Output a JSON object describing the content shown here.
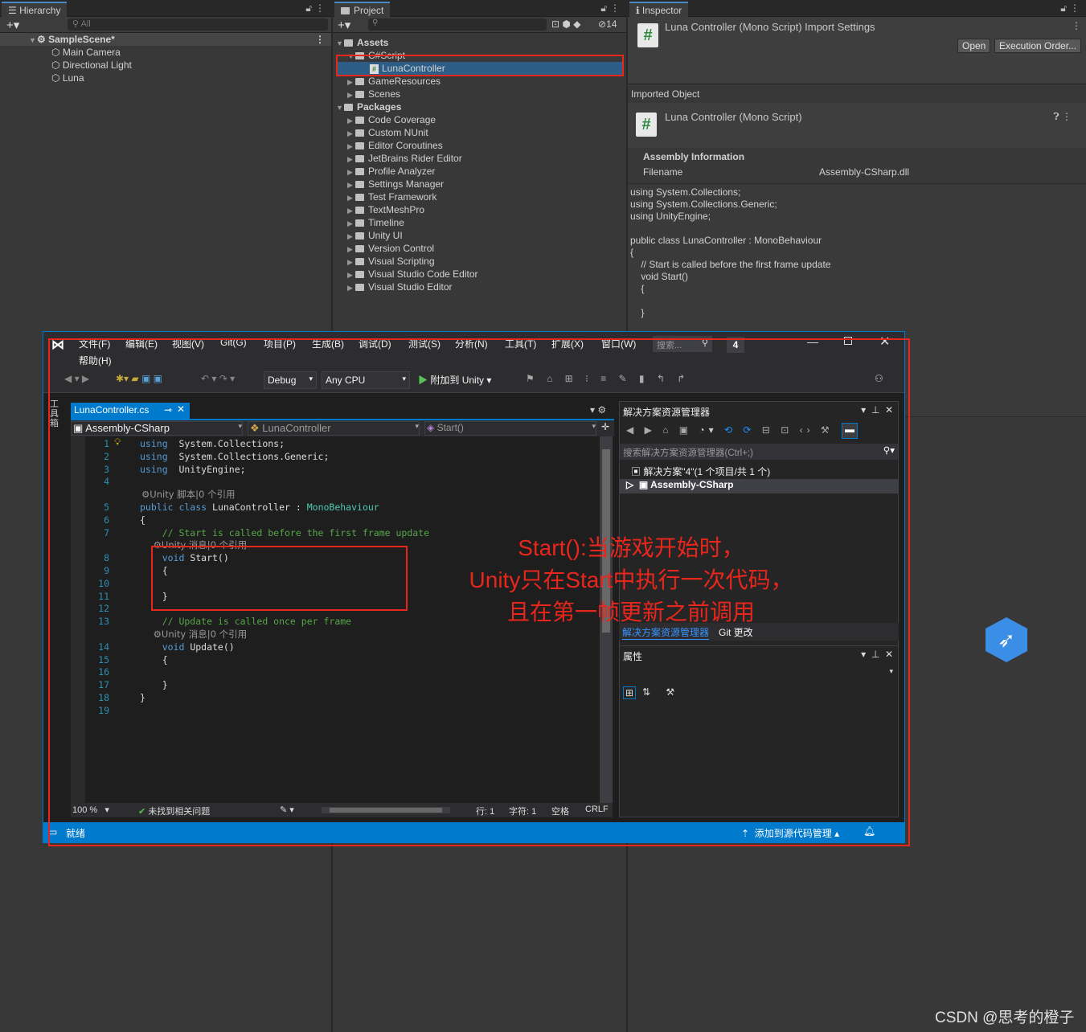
{
  "hierarchy": {
    "tab": "Hierarchy",
    "search_placeholder": "All",
    "scene": "SampleScene*",
    "items": [
      "Main Camera",
      "Directional Light",
      "Luna"
    ]
  },
  "project": {
    "tab": "Project",
    "badge": "14",
    "assets_label": "Assets",
    "folder_csharp": "C#Script",
    "selected_file": "LunaController",
    "asset_folders": [
      "GameResources",
      "Scenes"
    ],
    "packages_label": "Packages",
    "packages": [
      "Code Coverage",
      "Custom NUnit",
      "Editor Coroutines",
      "JetBrains Rider Editor",
      "Profile Analyzer",
      "Settings Manager",
      "Test Framework",
      "TextMeshPro",
      "Timeline",
      "Unity UI",
      "Version Control",
      "Visual Scripting",
      "Visual Studio Code Editor",
      "Visual Studio Editor"
    ]
  },
  "inspector": {
    "tab": "Inspector",
    "title": "Luna Controller (Mono Script) Import Settings",
    "open_btn": "Open",
    "exec_btn": "Execution Order...",
    "imported_object": "Imported Object",
    "object_name": "Luna Controller (Mono Script)",
    "assembly_info": "Assembly Information",
    "filename_label": "Filename",
    "filename_value": "Assembly-CSharp.dll",
    "code_lines": [
      "using System.Collections;",
      "using System.Collections.Generic;",
      "using UnityEngine;",
      "",
      "public class LunaController : MonoBehaviour",
      "{",
      "    // Start is called before the first frame update",
      "    void Start()",
      "    {",
      "",
      "    }"
    ]
  },
  "vs": {
    "menus": [
      "文件(F)",
      "编辑(E)",
      "视图(V)",
      "Git(G)",
      "项目(P)",
      "生成(B)",
      "调试(D)",
      "测试(S)",
      "分析(N)",
      "工具(T)",
      "扩展(X)",
      "窗口(W)"
    ],
    "help": "帮助(H)",
    "search": "搜索...",
    "badge": "4",
    "config": "Debug",
    "platform": "Any CPU",
    "attach": "附加到 Unity",
    "side_tab": "工具箱",
    "file_tab": "LunaController.cs",
    "nav_assembly": "Assembly-CSharp",
    "nav_class": "LunaController",
    "nav_method": "Start()",
    "zoom": "100 %",
    "issues": "未找到相关问题",
    "row_col": "行: 1",
    "char": "字符: 1",
    "space": "空格",
    "crlf": "CRLF",
    "status": "就绪",
    "source_ctrl": "添加到源代码管理",
    "code": [
      {
        "n": "1",
        "parts": [
          [
            "kw",
            "using"
          ],
          [
            "",
            "  System.Collections;"
          ]
        ]
      },
      {
        "n": "2",
        "parts": [
          [
            "kw",
            "using"
          ],
          [
            "",
            "  System.Collections.Generic;"
          ]
        ]
      },
      {
        "n": "3",
        "parts": [
          [
            "kw",
            "using"
          ],
          [
            "",
            "  UnityEngine;"
          ]
        ]
      },
      {
        "n": "4",
        "parts": []
      },
      {
        "n": "",
        "lens": "⚙Unity 脚本|0 个引用"
      },
      {
        "n": "5",
        "parts": [
          [
            "kw",
            "public class"
          ],
          [
            "",
            " LunaController : "
          ],
          [
            "ty",
            "MonoBehaviour"
          ]
        ]
      },
      {
        "n": "6",
        "parts": [
          [
            "",
            "{"
          ]
        ]
      },
      {
        "n": "7",
        "parts": [
          [
            "cm",
            "    // Start is called before the first frame update"
          ]
        ]
      },
      {
        "n": "",
        "lens": "    ⚙Unity 消息|0 个引用"
      },
      {
        "n": "8",
        "parts": [
          [
            "kw",
            "    void"
          ],
          [
            "",
            " Start()"
          ]
        ]
      },
      {
        "n": "9",
        "parts": [
          [
            "",
            "    {"
          ]
        ]
      },
      {
        "n": "10",
        "parts": []
      },
      {
        "n": "11",
        "parts": [
          [
            "",
            "    }"
          ]
        ]
      },
      {
        "n": "12",
        "parts": []
      },
      {
        "n": "13",
        "parts": [
          [
            "cm",
            "    // Update is called once per frame"
          ]
        ]
      },
      {
        "n": "",
        "lens": "    ⚙Unity 消息|0 个引用"
      },
      {
        "n": "14",
        "parts": [
          [
            "kw",
            "    void"
          ],
          [
            "",
            " Update()"
          ]
        ]
      },
      {
        "n": "15",
        "parts": [
          [
            "",
            "    {"
          ]
        ]
      },
      {
        "n": "16",
        "parts": []
      },
      {
        "n": "17",
        "parts": [
          [
            "",
            "    }"
          ]
        ]
      },
      {
        "n": "18",
        "parts": [
          [
            "",
            "}"
          ]
        ]
      },
      {
        "n": "19",
        "parts": []
      }
    ],
    "solution": {
      "title": "解决方案资源管理器",
      "search": "搜索解决方案资源管理器(Ctrl+;)",
      "root": "解决方案\"4\"(1 个项目/共 1 个)",
      "project": "Assembly-CSharp",
      "tab1": "解决方案资源管理器",
      "tab2": "Git 更改"
    },
    "props": {
      "title": "属性"
    }
  },
  "annotation": {
    "lines": [
      "Start():当游戏开始时，",
      "Unity只在Start中执行一次代码，",
      "且在第一帧更新之前调用"
    ]
  },
  "watermark": "CSDN @思考的橙子",
  "colors": {
    "accent": "#007acc",
    "red": "#e8261c",
    "unity_bg": "#383838"
  }
}
